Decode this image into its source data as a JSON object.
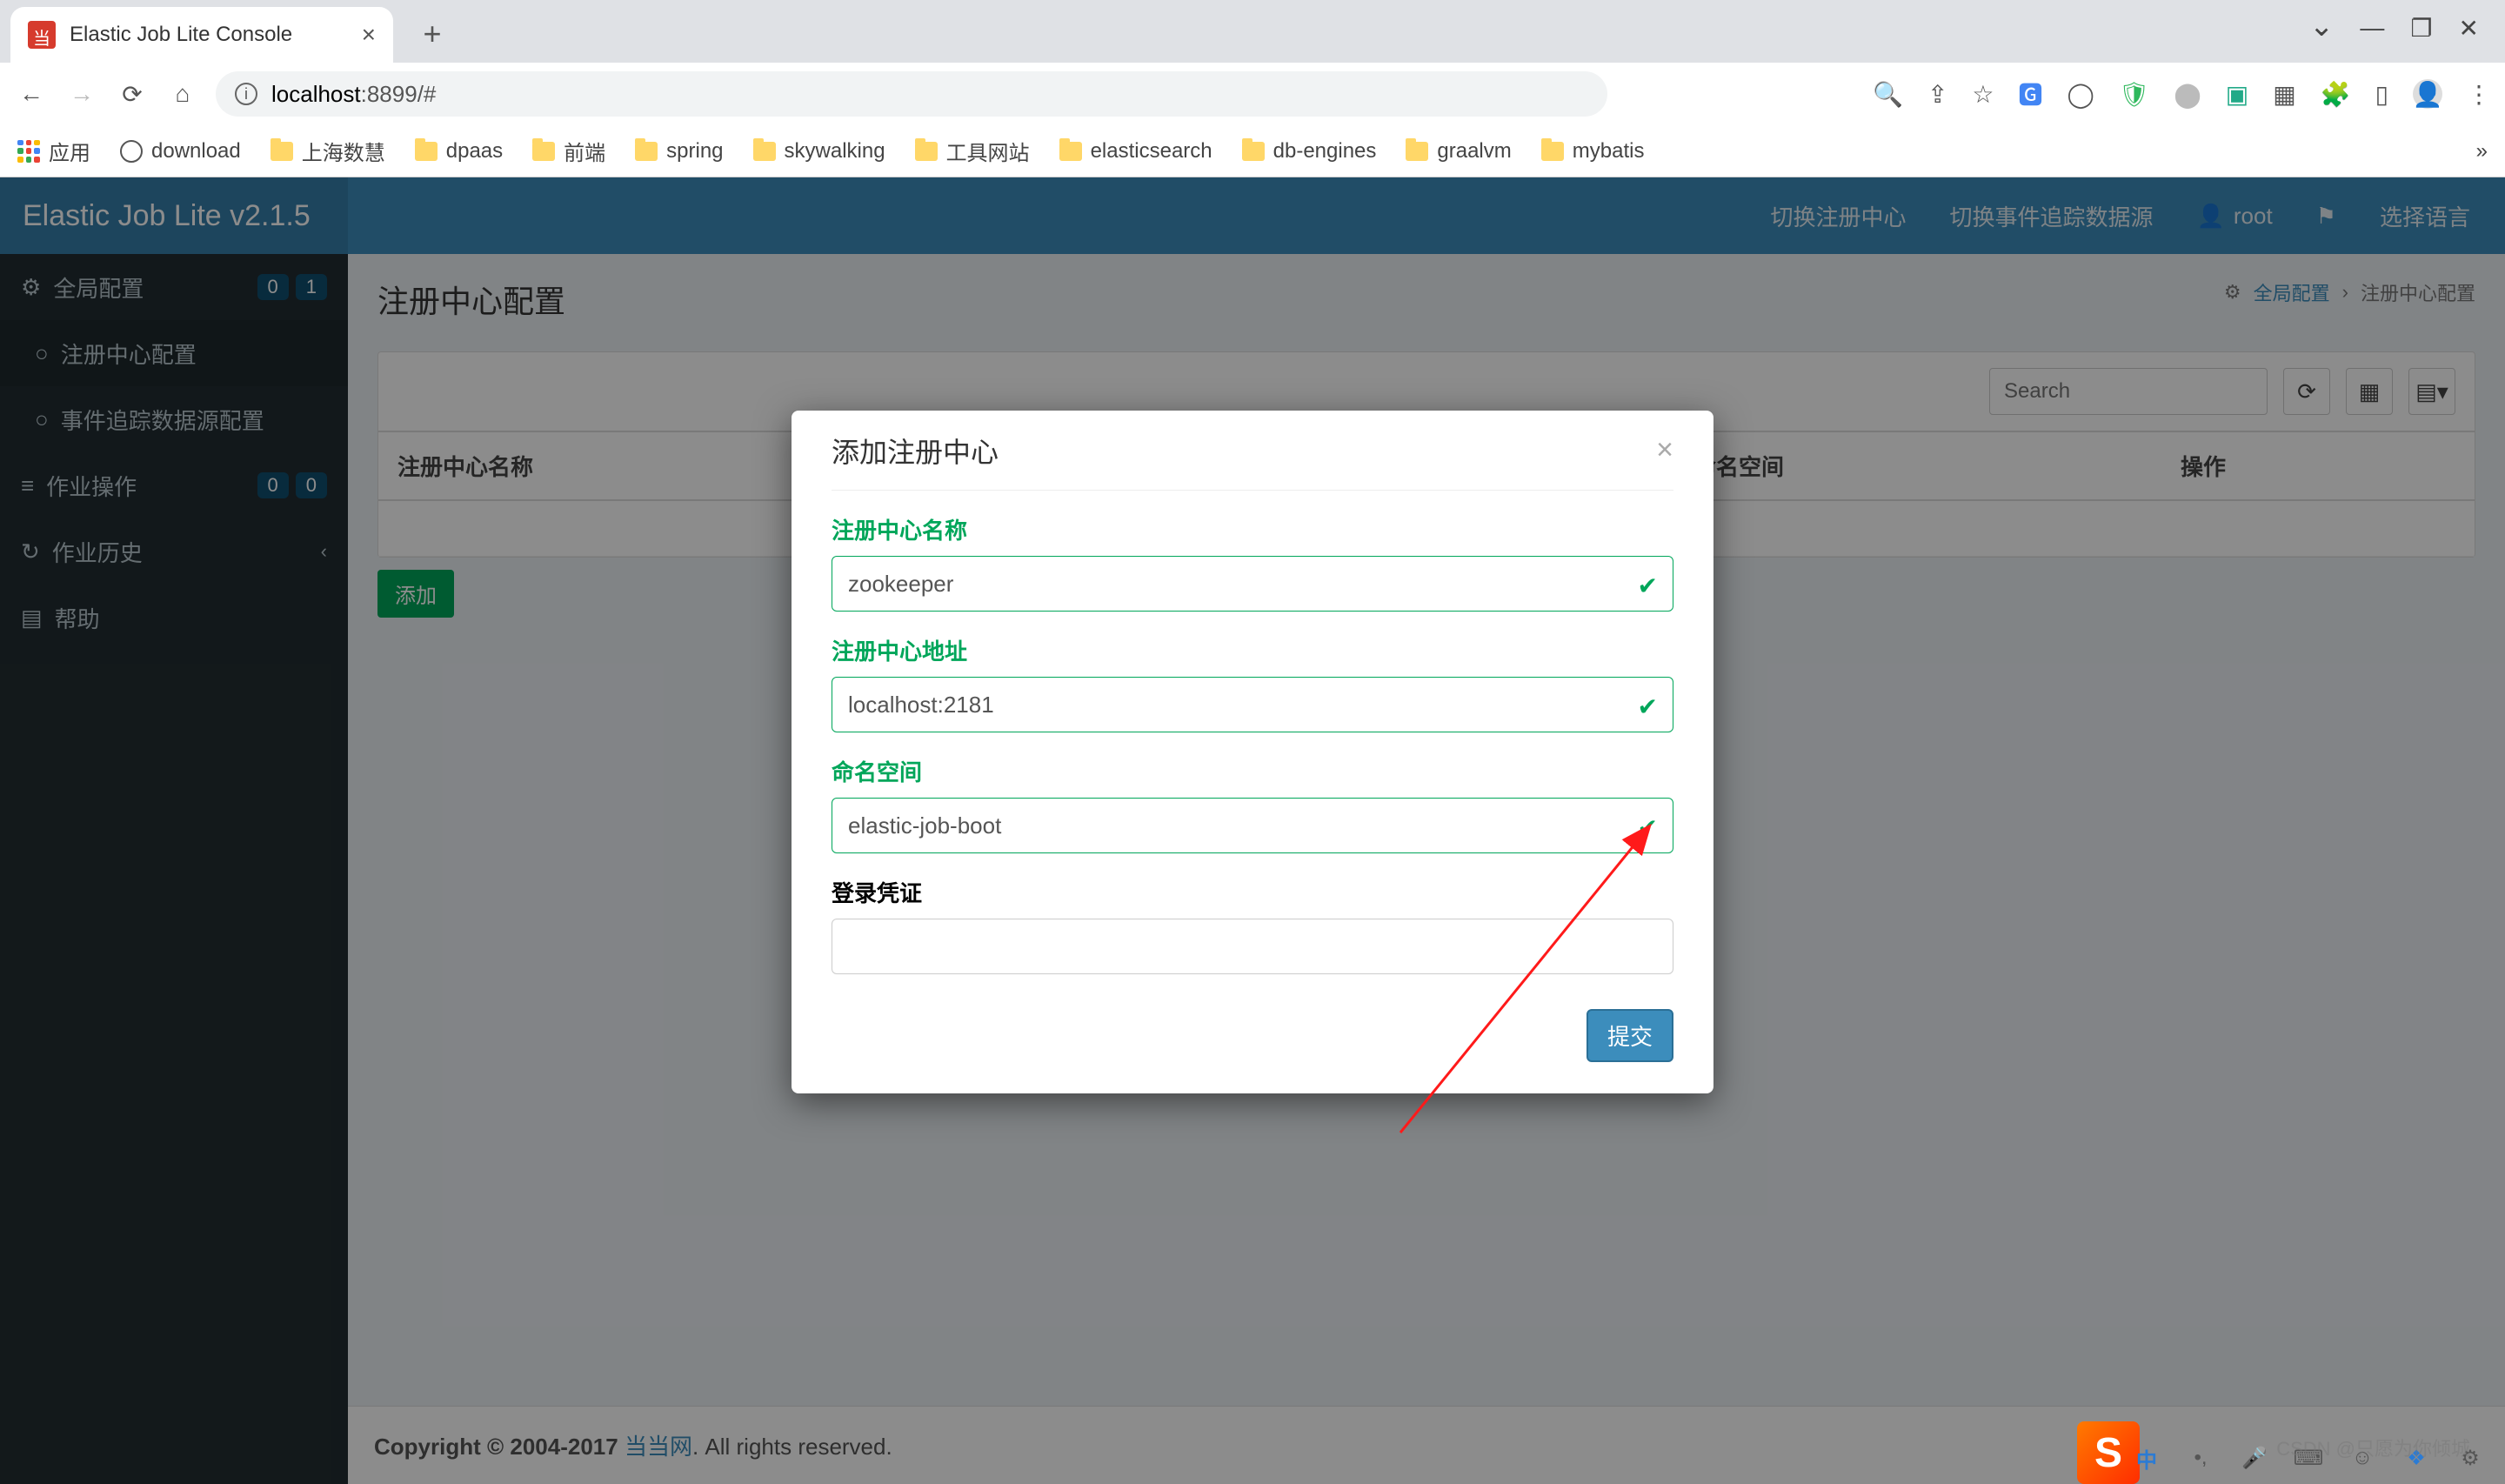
{
  "browser": {
    "tab_title": "Elastic Job Lite Console",
    "url_host": "localhost",
    "url_rest": ":8899/#",
    "bookmarks": {
      "apps": "应用",
      "download": "download",
      "items": [
        "上海数慧",
        "dpaas",
        "前端",
        "spring",
        "skywalking",
        "工具网站",
        "elasticsearch",
        "db-engines",
        "graalvm",
        "mybatis"
      ]
    }
  },
  "app": {
    "brand": "Elastic Job Lite v2.1.5",
    "topnav": {
      "switch_reg": "切换注册中心",
      "switch_trace": "切换事件追踪数据源",
      "user": "root",
      "lang": "选择语言"
    },
    "sidebar": {
      "global_cfg": "全局配置",
      "global_badges": [
        "0",
        "1"
      ],
      "reg_center_cfg": "注册中心配置",
      "trace_ds_cfg": "事件追踪数据源配置",
      "job_ops": "作业操作",
      "job_badges": [
        "0",
        "0"
      ],
      "job_history": "作业历史",
      "help": "帮助"
    },
    "page": {
      "title": "注册中心配置",
      "crumb_root": "全局配置",
      "crumb_leaf": "注册中心配置",
      "search_placeholder": "Search",
      "th_name": "注册中心名称",
      "th_ns": "命名空间",
      "th_ops": "操作",
      "add_btn": "添加"
    },
    "footer": {
      "copy_a": "Copyright © 2004-2017 ",
      "link": "当当网",
      "copy_b": ". All rights reserved."
    }
  },
  "modal": {
    "title": "添加注册中心",
    "f1_label": "注册中心名称",
    "f1_value": "zookeeper",
    "f2_label": "注册中心地址",
    "f2_value": "localhost:2181",
    "f3_label": "命名空间",
    "f3_value": "elastic-job-boot",
    "f4_label": "登录凭证",
    "f4_value": "",
    "submit": "提交"
  },
  "ime": {
    "s": "S",
    "zhong": "中"
  },
  "watermark": "CSDN @只愿为你倾城"
}
